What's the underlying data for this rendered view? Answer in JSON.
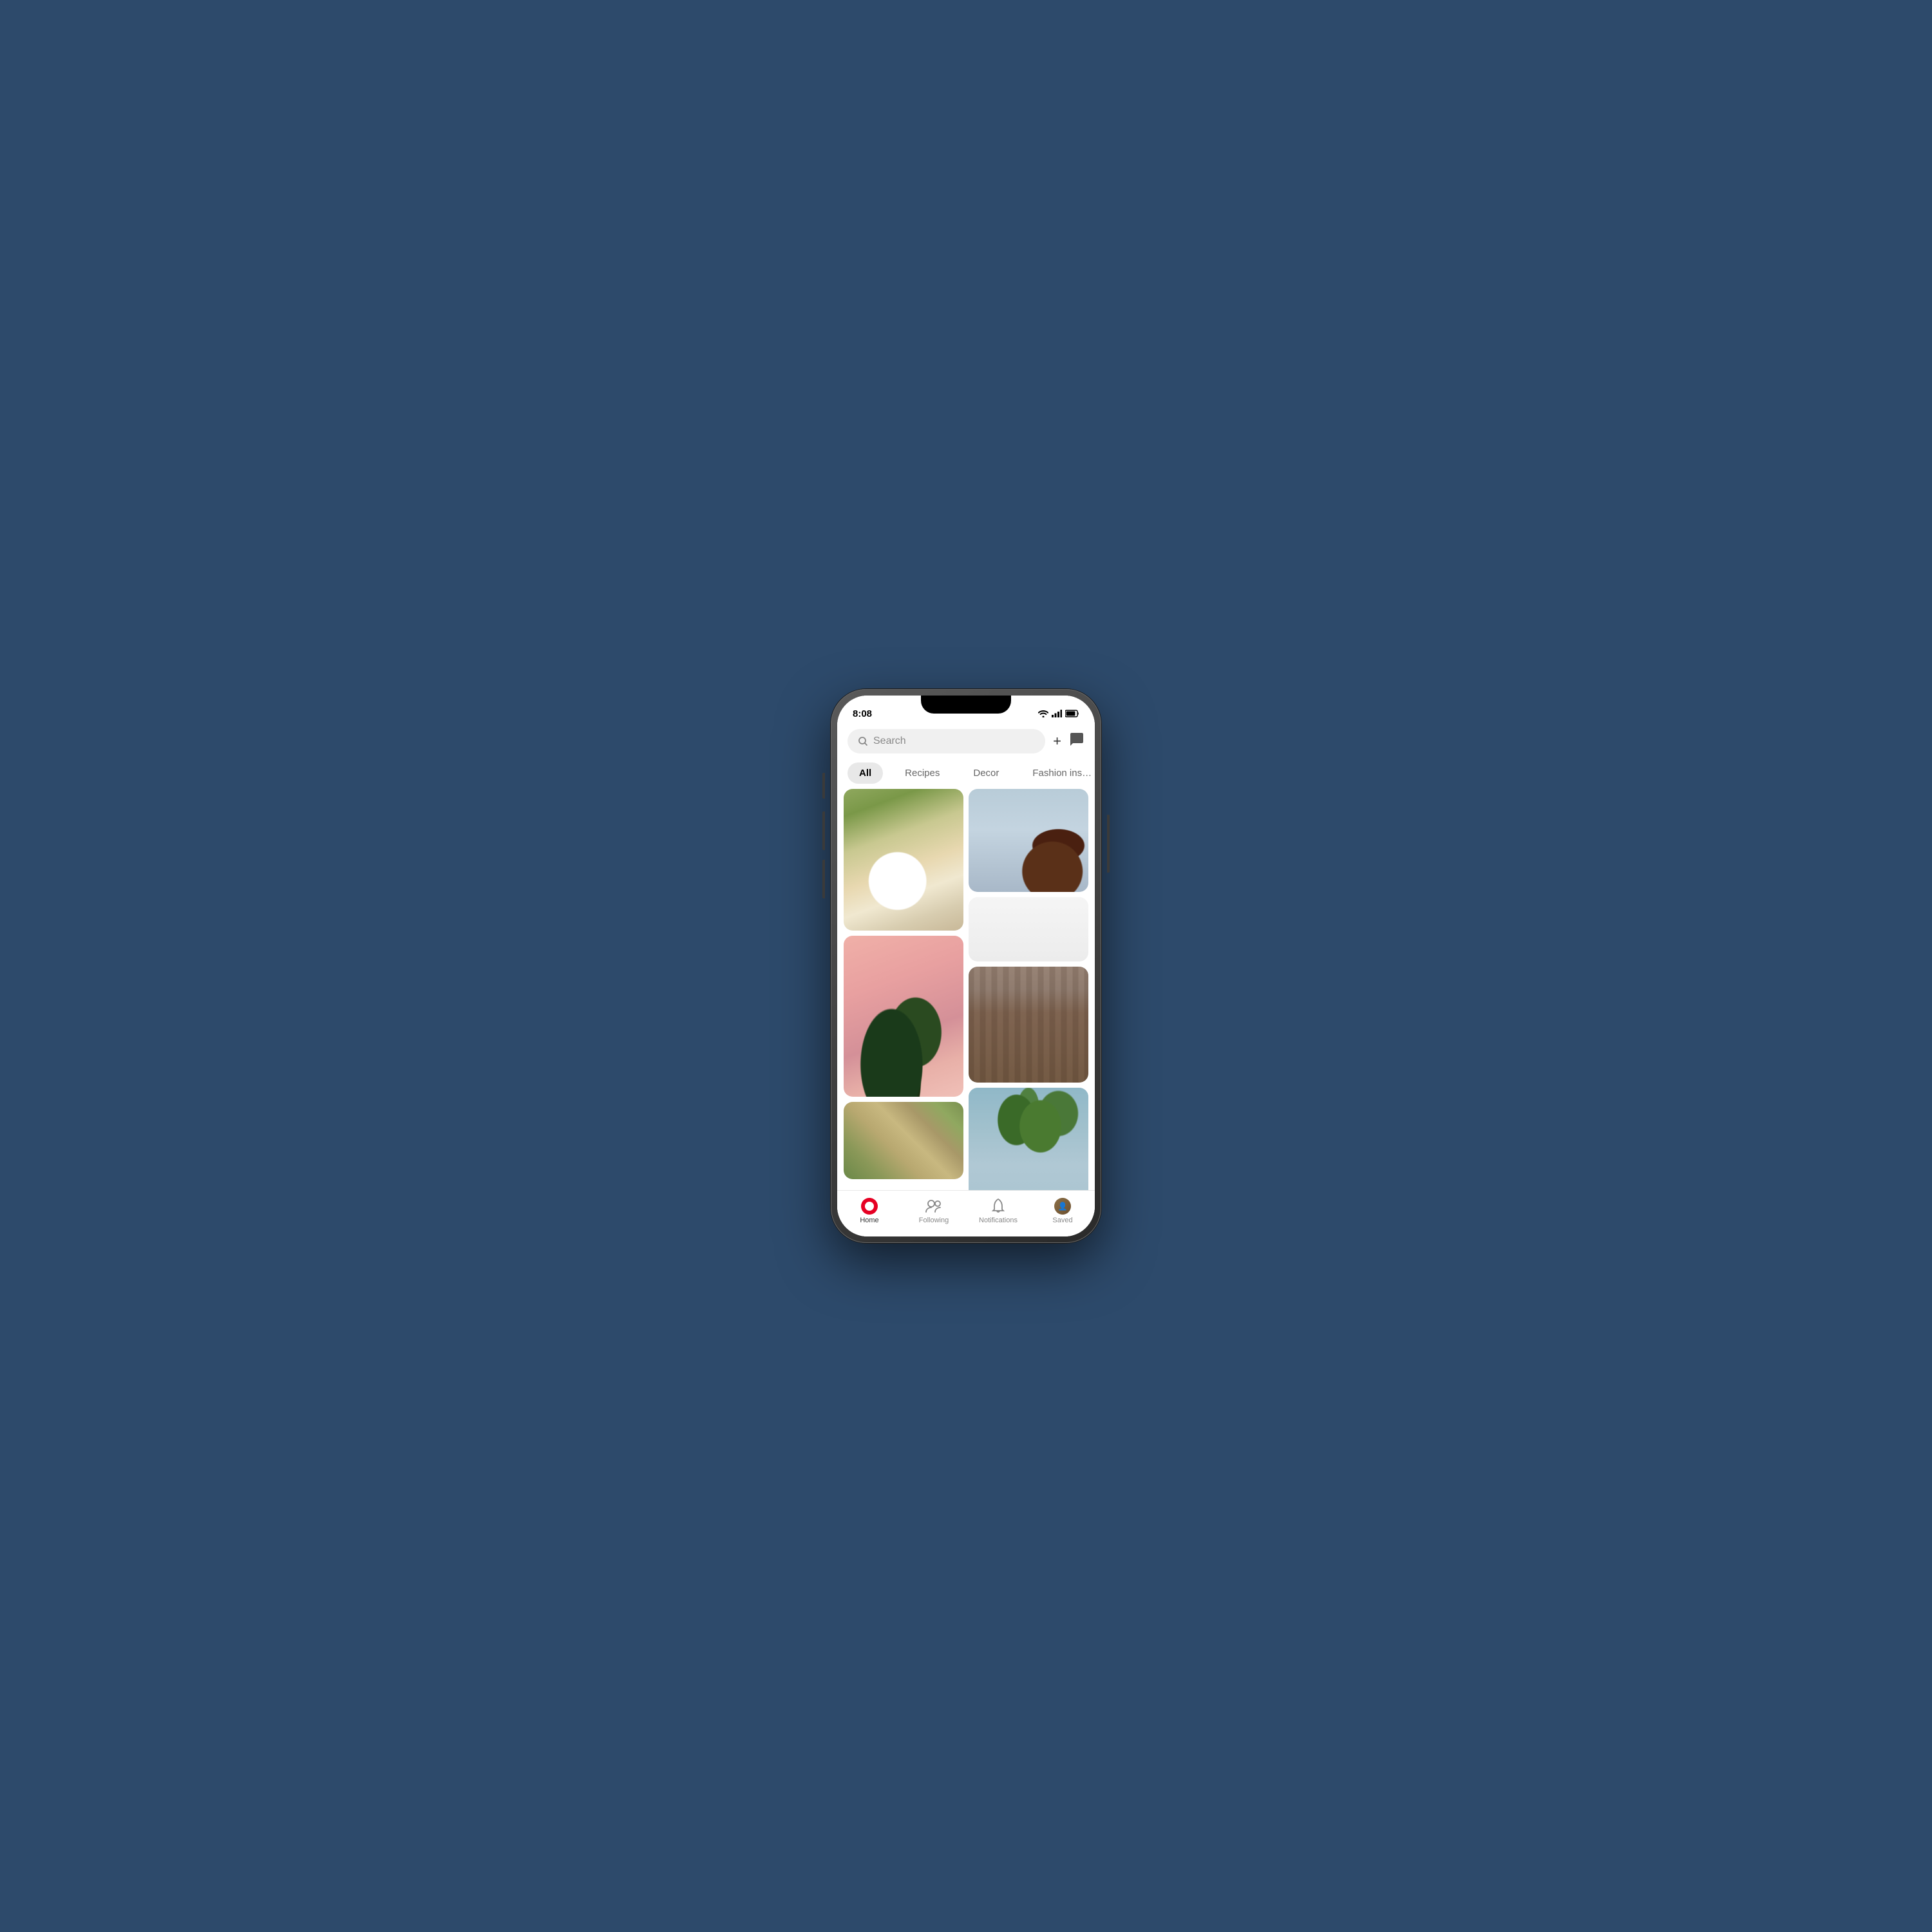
{
  "device": {
    "time": "8:08"
  },
  "header": {
    "search_placeholder": "Search",
    "add_label": "+",
    "message_label": "💬"
  },
  "categories": {
    "tabs": [
      {
        "id": "all",
        "label": "All",
        "active": true
      },
      {
        "id": "recipes",
        "label": "Recipes",
        "active": false
      },
      {
        "id": "decor",
        "label": "Decor",
        "active": false
      },
      {
        "id": "fashion",
        "label": "Fashion ins…",
        "active": false
      }
    ]
  },
  "pins": [
    {
      "id": "food",
      "type": "food",
      "col": "left",
      "aria": "Food with blueberries on white plate"
    },
    {
      "id": "dog",
      "type": "dog",
      "col": "right",
      "aria": "Brown dog with red collar"
    },
    {
      "id": "white",
      "type": "white",
      "col": "right",
      "aria": "White minimalist image"
    },
    {
      "id": "leaf",
      "type": "leaf",
      "col": "left",
      "aria": "Green leaf on pink background"
    },
    {
      "id": "buildings",
      "type": "buildings",
      "col": "right",
      "aria": "City buildings"
    },
    {
      "id": "aerial",
      "type": "aerial",
      "col": "left",
      "aria": "Aerial beach view"
    },
    {
      "id": "palm",
      "type": "palm",
      "col": "right",
      "aria": "Palm tree against blue sky"
    }
  ],
  "nav": {
    "items": [
      {
        "id": "home",
        "label": "Home",
        "active": true
      },
      {
        "id": "following",
        "label": "Following",
        "active": false
      },
      {
        "id": "notifications",
        "label": "Notifications",
        "active": false
      },
      {
        "id": "saved",
        "label": "Saved",
        "active": false
      }
    ]
  }
}
